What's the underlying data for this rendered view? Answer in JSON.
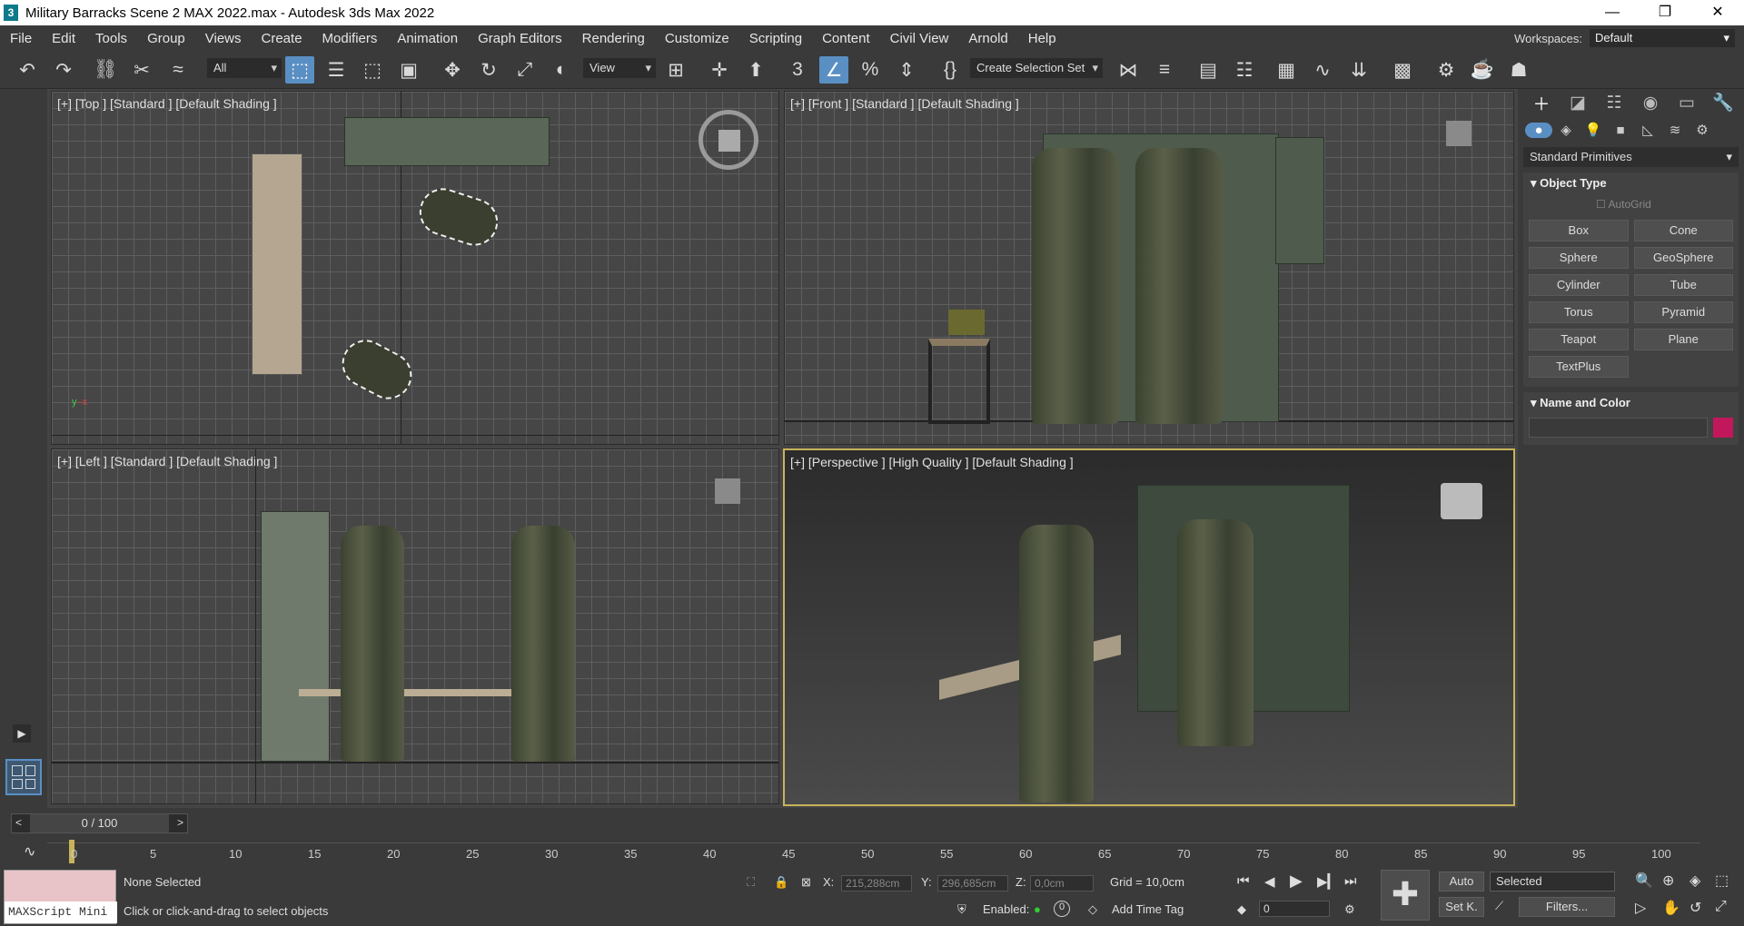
{
  "titlebar": {
    "title": "Military Barracks Scene 2 MAX 2022.max - Autodesk 3ds Max 2022",
    "minimize": "—",
    "restore": "❐",
    "close": "✕"
  },
  "menu": [
    "File",
    "Edit",
    "Tools",
    "Group",
    "Views",
    "Create",
    "Modifiers",
    "Animation",
    "Graph Editors",
    "Rendering",
    "Customize",
    "Scripting",
    "Content",
    "Civil View",
    "Arnold",
    "Help"
  ],
  "workspace": {
    "label": "Workspaces:",
    "value": "Default"
  },
  "toolbar": {
    "filter": "All",
    "ref_coord": "View",
    "selection_set": "Create Selection Set"
  },
  "viewports": {
    "top": "[+] [Top ] [Standard ] [Default Shading ]",
    "front": "[+] [Front ] [Standard ] [Default Shading ]",
    "left": "[+] [Left ] [Standard ] [Default Shading ]",
    "persp": "[+] [Perspective ] [High Quality ] [Default Shading ]"
  },
  "command_panel": {
    "category": "Standard Primitives",
    "object_type": "Object Type",
    "autogrid": "AutoGrid",
    "buttons": [
      "Box",
      "Cone",
      "Sphere",
      "GeoSphere",
      "Cylinder",
      "Tube",
      "Torus",
      "Pyramid",
      "Teapot",
      "Plane",
      "TextPlus"
    ],
    "name_color": "Name and Color",
    "color": "#c2185b"
  },
  "timeline": {
    "frame": "0 / 100",
    "ticks": [
      "0",
      "5",
      "10",
      "15",
      "20",
      "25",
      "30",
      "35",
      "40",
      "45",
      "50",
      "55",
      "60",
      "65",
      "70",
      "75",
      "80",
      "85",
      "90",
      "95",
      "100"
    ]
  },
  "status": {
    "selection": "None Selected",
    "prompt": "Click or click-and-drag to select objects",
    "maxscript": "MAXScript Mini",
    "x_label": "X:",
    "x": "215,288cm",
    "y_label": "Y:",
    "y": "296,685cm",
    "z_label": "Z:",
    "z": "0,0cm",
    "grid": "Grid = 10,0cm",
    "enabled": "Enabled:",
    "enabled_val": "0",
    "add_time_tag": "Add Time Tag",
    "auto": "Auto",
    "selected": "Selected",
    "setk": "Set K.",
    "filters": "Filters...",
    "frame_field": "0"
  }
}
